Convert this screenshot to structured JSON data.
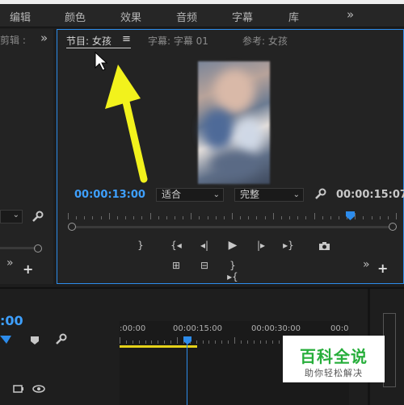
{
  "menu": {
    "items": [
      "编辑",
      "颜色",
      "效果",
      "音频",
      "字幕",
      "库"
    ],
    "more": "»"
  },
  "left_panel": {
    "tab_label": "剪辑 :",
    "more": "»"
  },
  "monitor": {
    "tabs": [
      "节目: 女孩",
      "字幕: 字幕 01",
      "参考: 女孩"
    ],
    "tab_menu_icon": "≡",
    "current_timecode": "00:00:13:00",
    "duration_timecode": "00:00:15:07",
    "fit_select": "适合",
    "quality_select": "完整",
    "playhead_fraction": 0.86,
    "more": "»",
    "add": "+"
  },
  "timeline": {
    "timecode_partial": ":00",
    "ruler_labels": [
      ":00:00",
      "00:00:15:00",
      "00:00:30:00",
      "00:0"
    ]
  },
  "watermark": {
    "title": "百科全说",
    "subtitle": "助你轻松解决"
  },
  "colors": {
    "accent_blue": "#2d8ceb",
    "timecode_blue": "#3ea0ff",
    "arrow_yellow": "#f2f21c",
    "work_area_yellow": "#e6d21a",
    "watermark_green": "#27ae3b"
  }
}
